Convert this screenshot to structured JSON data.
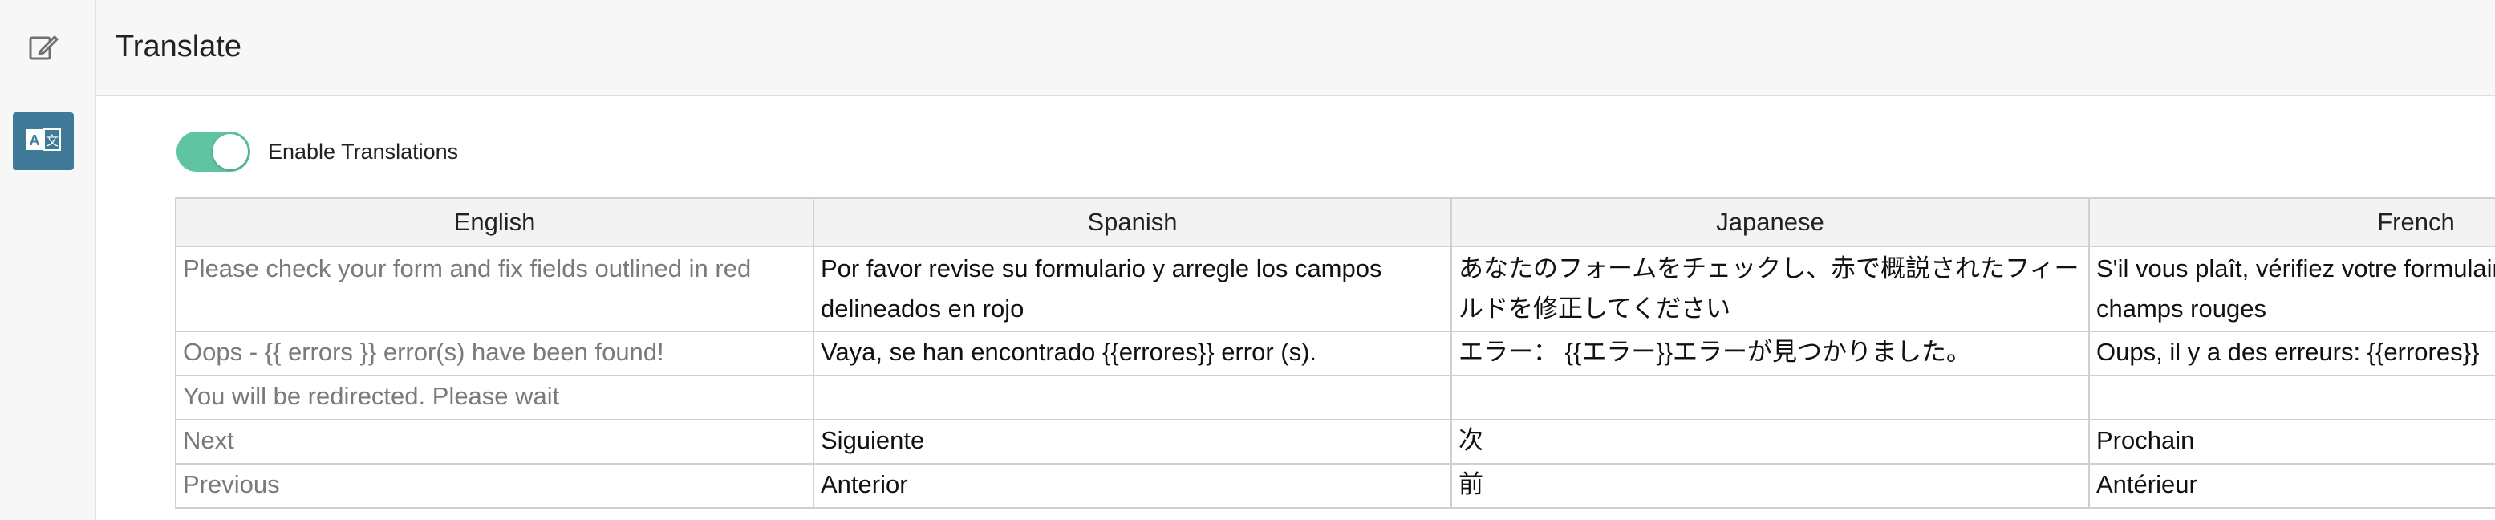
{
  "header": {
    "title": "Translate"
  },
  "rail": {
    "items": [
      {
        "icon": "edit-icon",
        "active": false
      },
      {
        "icon": "translate-icon",
        "active": true,
        "glyph_left": "A",
        "glyph_right": "文"
      }
    ]
  },
  "toggle": {
    "label": "Enable Translations",
    "on": true,
    "color": "#5fc4a2"
  },
  "table": {
    "columns": [
      "English",
      "Spanish",
      "Japanese",
      "French"
    ],
    "rows": [
      [
        "Please check your form and fix fields outlined in red",
        "Por favor revise su formulario y arregle los campos delineados en rojo",
        "あなたのフォームをチェックし、赤で概説されたフィールドを修正してください",
        "S'il vous plaît, vérifiez votre formulaire et corrigez les champs rouges"
      ],
      [
        "Oops - {{ errors }} error(s) have been found!",
        "Vaya, se han encontrado {{errores}} error (s).",
        "エラー： {{エラー}}エラーが見つかりました。",
        "Oups, il y a des erreurs: {{errores}}"
      ],
      [
        "You will be redirected. Please wait",
        "",
        "",
        ""
      ],
      [
        "Next",
        "Siguiente",
        "次",
        "Prochain"
      ],
      [
        "Previous",
        "Anterior",
        "前",
        "Antérieur"
      ]
    ]
  },
  "colors": {
    "accent": "#3f7b98",
    "toggle_on": "#5fc4a2",
    "header_bg": "#f7f7f7",
    "grid_line": "#d0d0d0"
  }
}
